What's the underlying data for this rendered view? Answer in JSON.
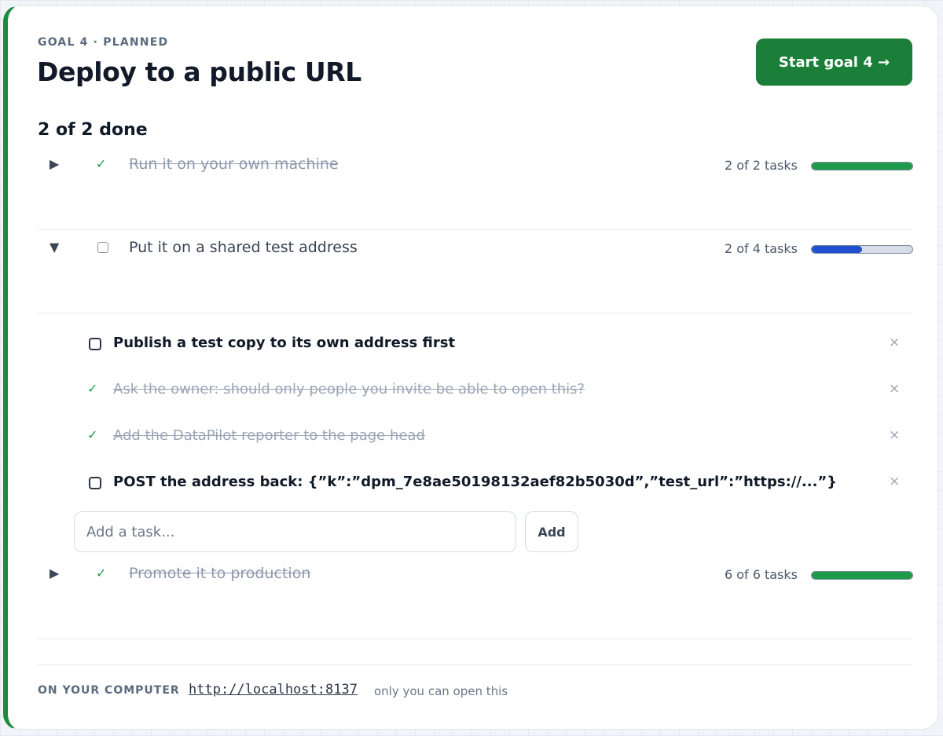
{
  "goal": {
    "kicker": "GOAL 4 · PLANNED",
    "title": "Deploy to a public URL",
    "start_button": "Start goal 4 →",
    "summary": "2 of 2 done"
  },
  "steps": [
    {
      "label": "Run it on your own machine",
      "done": true,
      "expanded": false,
      "toggle": "▶",
      "status": "✓",
      "task_count": "2 of 2 tasks",
      "progress": 1.0
    },
    {
      "label": "Put it on a shared test address",
      "done": false,
      "expanded": true,
      "toggle": "▼",
      "status": "",
      "task_count": "2 of 4 tasks",
      "progress": 0.5
    },
    {
      "label": "Promote it to production",
      "done": true,
      "expanded": false,
      "toggle": "▶",
      "status": "✓",
      "task_count": "6 of 6 tasks",
      "progress": 1.0
    }
  ],
  "subtasks": [
    {
      "label": "Publish a test copy to its own address first",
      "done": false
    },
    {
      "label": "Ask the owner: should only people you invite be able to open this?",
      "done": true,
      "check": "✓"
    },
    {
      "label": "Add the DataPilot reporter to the page head",
      "done": true,
      "check": "✓"
    },
    {
      "label": "POST the address back: {”k”:”dpm_7e8ae50198132aef82b5030d”,”test_url”:”https://...”}",
      "done": false
    }
  ],
  "remove_glyph": "×",
  "add_task": {
    "placeholder": "Add a task...",
    "button": "Add"
  },
  "footer": {
    "label": "ON YOUR COMPUTER",
    "url": "http://localhost:8137",
    "note": "only you can open this"
  },
  "colors": {
    "accent_green": "#1b7f39",
    "done_green": "#1e9a4b",
    "active_blue": "#2050d0"
  }
}
